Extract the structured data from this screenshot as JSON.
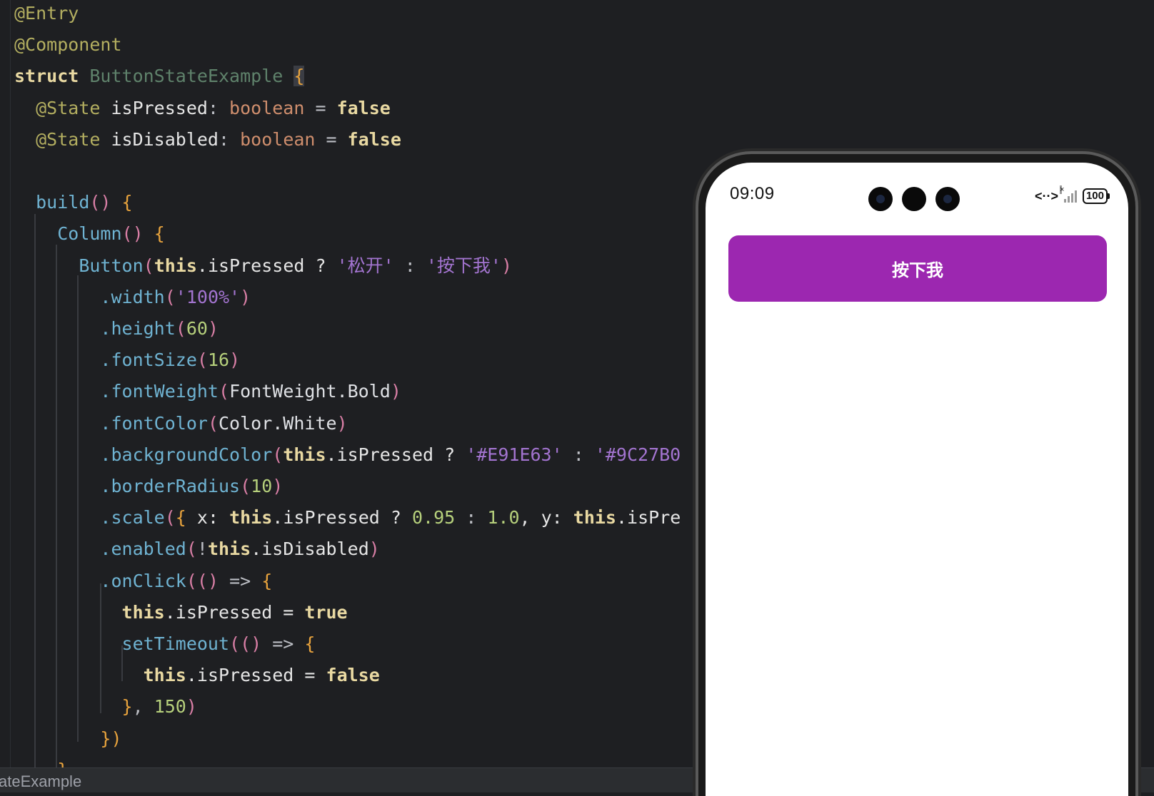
{
  "editor": {
    "lines": [
      [
        {
          "t": "@Entry",
          "c": "ann"
        }
      ],
      [
        {
          "t": "@Component",
          "c": "ann"
        }
      ],
      [
        {
          "t": "struct",
          "c": "kwb"
        },
        {
          "t": " ",
          "c": "punc"
        },
        {
          "t": "ButtonStateExample",
          "c": "cls"
        },
        {
          "t": " ",
          "c": "punc"
        },
        {
          "t": "{",
          "c": "brace caret-brace"
        }
      ],
      [
        {
          "t": "  ",
          "c": "punc"
        },
        {
          "t": "@State",
          "c": "ann"
        },
        {
          "t": " isPressed",
          "c": "prop"
        },
        {
          "t": ": ",
          "c": "punc"
        },
        {
          "t": "boolean",
          "c": "ty"
        },
        {
          "t": " = ",
          "c": "punc"
        },
        {
          "t": "false",
          "c": "bool"
        }
      ],
      [
        {
          "t": "  ",
          "c": "punc"
        },
        {
          "t": "@State",
          "c": "ann"
        },
        {
          "t": " isDisabled",
          "c": "prop"
        },
        {
          "t": ": ",
          "c": "punc"
        },
        {
          "t": "boolean",
          "c": "ty"
        },
        {
          "t": " = ",
          "c": "punc"
        },
        {
          "t": "false",
          "c": "bool"
        }
      ],
      [],
      [
        {
          "t": "  ",
          "c": "punc"
        },
        {
          "t": "build",
          "c": "fnc"
        },
        {
          "t": "()",
          "c": "paren"
        },
        {
          "t": " ",
          "c": "punc"
        },
        {
          "t": "{",
          "c": "brace"
        }
      ],
      [
        {
          "t": "    ",
          "c": "punc"
        },
        {
          "t": "Column",
          "c": "fnc"
        },
        {
          "t": "()",
          "c": "paren"
        },
        {
          "t": " ",
          "c": "punc"
        },
        {
          "t": "{",
          "c": "brace"
        }
      ],
      [
        {
          "t": "      ",
          "c": "punc"
        },
        {
          "t": "Button",
          "c": "fnc"
        },
        {
          "t": "(",
          "c": "paren"
        },
        {
          "t": "this",
          "c": "kwb"
        },
        {
          "t": ".isPressed ? ",
          "c": "prop"
        },
        {
          "t": "'松开'",
          "c": "str"
        },
        {
          "t": " : ",
          "c": "punc"
        },
        {
          "t": "'按下我'",
          "c": "str"
        },
        {
          "t": ")",
          "c": "paren"
        }
      ],
      [
        {
          "t": "        ",
          "c": "punc"
        },
        {
          "t": ".width",
          "c": "fnc"
        },
        {
          "t": "(",
          "c": "paren"
        },
        {
          "t": "'100%'",
          "c": "str"
        },
        {
          "t": ")",
          "c": "paren"
        }
      ],
      [
        {
          "t": "        ",
          "c": "punc"
        },
        {
          "t": ".height",
          "c": "fnc"
        },
        {
          "t": "(",
          "c": "paren"
        },
        {
          "t": "60",
          "c": "num"
        },
        {
          "t": ")",
          "c": "paren"
        }
      ],
      [
        {
          "t": "        ",
          "c": "punc"
        },
        {
          "t": ".fontSize",
          "c": "fnc"
        },
        {
          "t": "(",
          "c": "paren"
        },
        {
          "t": "16",
          "c": "num"
        },
        {
          "t": ")",
          "c": "paren"
        }
      ],
      [
        {
          "t": "        ",
          "c": "punc"
        },
        {
          "t": ".fontWeight",
          "c": "fnc"
        },
        {
          "t": "(",
          "c": "paren"
        },
        {
          "t": "FontWeight.Bold",
          "c": "wh"
        },
        {
          "t": ")",
          "c": "paren"
        }
      ],
      [
        {
          "t": "        ",
          "c": "punc"
        },
        {
          "t": ".fontColor",
          "c": "fnc"
        },
        {
          "t": "(",
          "c": "paren"
        },
        {
          "t": "Color.White",
          "c": "wh"
        },
        {
          "t": ")",
          "c": "paren"
        }
      ],
      [
        {
          "t": "        ",
          "c": "punc"
        },
        {
          "t": ".backgroundColor",
          "c": "fnc"
        },
        {
          "t": "(",
          "c": "paren"
        },
        {
          "t": "this",
          "c": "kwb"
        },
        {
          "t": ".isPressed ? ",
          "c": "prop"
        },
        {
          "t": "'#E91E63'",
          "c": "str"
        },
        {
          "t": " : ",
          "c": "punc"
        },
        {
          "t": "'#9C27B0",
          "c": "str"
        }
      ],
      [
        {
          "t": "        ",
          "c": "punc"
        },
        {
          "t": ".borderRadius",
          "c": "fnc"
        },
        {
          "t": "(",
          "c": "paren"
        },
        {
          "t": "10",
          "c": "num"
        },
        {
          "t": ")",
          "c": "paren"
        }
      ],
      [
        {
          "t": "        ",
          "c": "punc"
        },
        {
          "t": ".scale",
          "c": "fnc"
        },
        {
          "t": "(",
          "c": "paren"
        },
        {
          "t": "{",
          "c": "brace"
        },
        {
          "t": " x: ",
          "c": "prop"
        },
        {
          "t": "this",
          "c": "kwb"
        },
        {
          "t": ".isPressed ? ",
          "c": "prop"
        },
        {
          "t": "0.95",
          "c": "num"
        },
        {
          "t": " : ",
          "c": "punc"
        },
        {
          "t": "1.0",
          "c": "num"
        },
        {
          "t": ", y: ",
          "c": "prop"
        },
        {
          "t": "this",
          "c": "kwb"
        },
        {
          "t": ".isPre",
          "c": "prop"
        }
      ],
      [
        {
          "t": "        ",
          "c": "punc"
        },
        {
          "t": ".enabled",
          "c": "fnc"
        },
        {
          "t": "(",
          "c": "paren"
        },
        {
          "t": "!",
          "c": "punc"
        },
        {
          "t": "this",
          "c": "kwb"
        },
        {
          "t": ".isDisabled",
          "c": "prop"
        },
        {
          "t": ")",
          "c": "paren"
        }
      ],
      [
        {
          "t": "        ",
          "c": "punc"
        },
        {
          "t": ".onClick",
          "c": "fnc"
        },
        {
          "t": "(",
          "c": "paren"
        },
        {
          "t": "()",
          "c": "paren"
        },
        {
          "t": " => ",
          "c": "punc"
        },
        {
          "t": "{",
          "c": "brace"
        }
      ],
      [
        {
          "t": "          ",
          "c": "punc"
        },
        {
          "t": "this",
          "c": "kwb"
        },
        {
          "t": ".isPressed = ",
          "c": "prop"
        },
        {
          "t": "true",
          "c": "bool"
        }
      ],
      [
        {
          "t": "          ",
          "c": "punc"
        },
        {
          "t": "setTimeout",
          "c": "fnc"
        },
        {
          "t": "(",
          "c": "paren"
        },
        {
          "t": "()",
          "c": "paren"
        },
        {
          "t": " => ",
          "c": "punc"
        },
        {
          "t": "{",
          "c": "brace"
        }
      ],
      [
        {
          "t": "            ",
          "c": "punc"
        },
        {
          "t": "this",
          "c": "kwb"
        },
        {
          "t": ".isPressed = ",
          "c": "prop"
        },
        {
          "t": "false",
          "c": "bool"
        }
      ],
      [
        {
          "t": "          ",
          "c": "punc"
        },
        {
          "t": "}",
          "c": "brace"
        },
        {
          "t": ", ",
          "c": "punc"
        },
        {
          "t": "150",
          "c": "num"
        },
        {
          "t": ")",
          "c": "paren"
        }
      ],
      [
        {
          "t": "        ",
          "c": "punc"
        },
        {
          "t": "})",
          "c": "brace"
        }
      ],
      [
        {
          "t": "    ",
          "c": "punc"
        },
        {
          "t": "}",
          "c": "brace"
        }
      ]
    ]
  },
  "statusbar": {
    "breadcrumb": "ateExample"
  },
  "phone": {
    "time": "09:09",
    "battery": "100",
    "sync_glyph": "<··>",
    "icons": [
      "camera-icon",
      "sync-icon",
      "signal-icon",
      "battery-icon"
    ],
    "button": {
      "label": "按下我",
      "color": "#9c27b0"
    }
  }
}
